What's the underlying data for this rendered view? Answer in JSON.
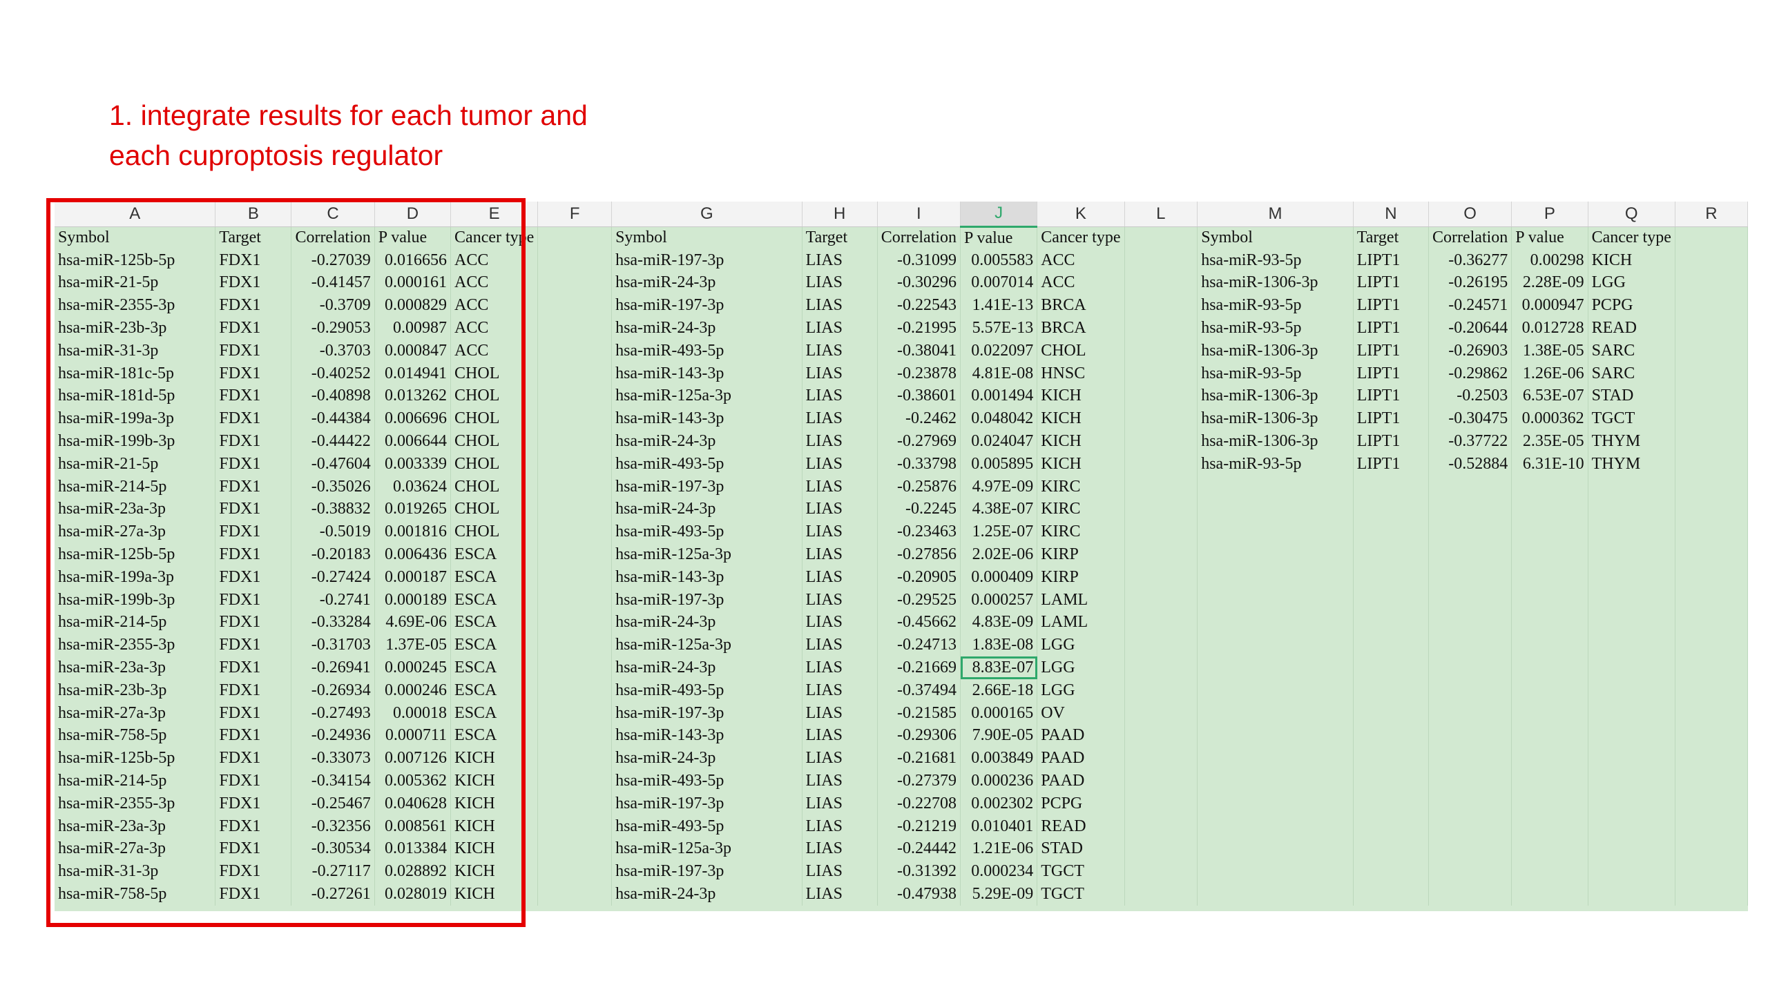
{
  "caption": {
    "line1": "1. integrate results for each tumor and",
    "line2": "each cuproptosis regulator"
  },
  "sheet": {
    "columns": [
      "A",
      "B",
      "C",
      "D",
      "E",
      "F",
      "G",
      "H",
      "I",
      "J",
      "K",
      "L",
      "M",
      "N",
      "O",
      "P",
      "Q",
      "R"
    ],
    "selected_column": "J",
    "header_row": [
      "Symbol",
      "Target",
      "Correlation",
      "P value",
      "Cancer type",
      "",
      "Symbol",
      "Target",
      "Correlation",
      "P value",
      "Cancer type",
      "",
      "Symbol",
      "Target",
      "Correlation",
      "P value",
      "Cancer type",
      ""
    ],
    "rows": [
      [
        "hsa-miR-125b-5p",
        "FDX1",
        "-0.27039",
        "0.016656",
        "ACC",
        "",
        "hsa-miR-197-3p",
        "LIAS",
        "-0.31099",
        "0.005583",
        "ACC",
        "",
        "hsa-miR-93-5p",
        "LIPT1",
        "-0.36277",
        "0.00298",
        "KICH",
        ""
      ],
      [
        "hsa-miR-21-5p",
        "FDX1",
        "-0.41457",
        "0.000161",
        "ACC",
        "",
        "hsa-miR-24-3p",
        "LIAS",
        "-0.30296",
        "0.007014",
        "ACC",
        "",
        "hsa-miR-1306-3p",
        "LIPT1",
        "-0.26195",
        "2.28E-09",
        "LGG",
        ""
      ],
      [
        "hsa-miR-2355-3p",
        "FDX1",
        "-0.3709",
        "0.000829",
        "ACC",
        "",
        "hsa-miR-197-3p",
        "LIAS",
        "-0.22543",
        "1.41E-13",
        "BRCA",
        "",
        "hsa-miR-93-5p",
        "LIPT1",
        "-0.24571",
        "0.000947",
        "PCPG",
        ""
      ],
      [
        "hsa-miR-23b-3p",
        "FDX1",
        "-0.29053",
        "0.00987",
        "ACC",
        "",
        "hsa-miR-24-3p",
        "LIAS",
        "-0.21995",
        "5.57E-13",
        "BRCA",
        "",
        "hsa-miR-93-5p",
        "LIPT1",
        "-0.20644",
        "0.012728",
        "READ",
        ""
      ],
      [
        "hsa-miR-31-3p",
        "FDX1",
        "-0.3703",
        "0.000847",
        "ACC",
        "",
        "hsa-miR-493-5p",
        "LIAS",
        "-0.38041",
        "0.022097",
        "CHOL",
        "",
        "hsa-miR-1306-3p",
        "LIPT1",
        "-0.26903",
        "1.38E-05",
        "SARC",
        ""
      ],
      [
        "hsa-miR-181c-5p",
        "FDX1",
        "-0.40252",
        "0.014941",
        "CHOL",
        "",
        "hsa-miR-143-3p",
        "LIAS",
        "-0.23878",
        "4.81E-08",
        "HNSC",
        "",
        "hsa-miR-93-5p",
        "LIPT1",
        "-0.29862",
        "1.26E-06",
        "SARC",
        ""
      ],
      [
        "hsa-miR-181d-5p",
        "FDX1",
        "-0.40898",
        "0.013262",
        "CHOL",
        "",
        "hsa-miR-125a-3p",
        "LIAS",
        "-0.38601",
        "0.001494",
        "KICH",
        "",
        "hsa-miR-1306-3p",
        "LIPT1",
        "-0.2503",
        "6.53E-07",
        "STAD",
        ""
      ],
      [
        "hsa-miR-199a-3p",
        "FDX1",
        "-0.44384",
        "0.006696",
        "CHOL",
        "",
        "hsa-miR-143-3p",
        "LIAS",
        "-0.2462",
        "0.048042",
        "KICH",
        "",
        "hsa-miR-1306-3p",
        "LIPT1",
        "-0.30475",
        "0.000362",
        "TGCT",
        ""
      ],
      [
        "hsa-miR-199b-3p",
        "FDX1",
        "-0.44422",
        "0.006644",
        "CHOL",
        "",
        "hsa-miR-24-3p",
        "LIAS",
        "-0.27969",
        "0.024047",
        "KICH",
        "",
        "hsa-miR-1306-3p",
        "LIPT1",
        "-0.37722",
        "2.35E-05",
        "THYM",
        ""
      ],
      [
        "hsa-miR-21-5p",
        "FDX1",
        "-0.47604",
        "0.003339",
        "CHOL",
        "",
        "hsa-miR-493-5p",
        "LIAS",
        "-0.33798",
        "0.005895",
        "KICH",
        "",
        "hsa-miR-93-5p",
        "LIPT1",
        "-0.52884",
        "6.31E-10",
        "THYM",
        ""
      ],
      [
        "hsa-miR-214-5p",
        "FDX1",
        "-0.35026",
        "0.03624",
        "CHOL",
        "",
        "hsa-miR-197-3p",
        "LIAS",
        "-0.25876",
        "4.97E-09",
        "KIRC",
        "",
        "",
        "",
        "",
        "",
        "",
        ""
      ],
      [
        "hsa-miR-23a-3p",
        "FDX1",
        "-0.38832",
        "0.019265",
        "CHOL",
        "",
        "hsa-miR-24-3p",
        "LIAS",
        "-0.2245",
        "4.38E-07",
        "KIRC",
        "",
        "",
        "",
        "",
        "",
        "",
        ""
      ],
      [
        "hsa-miR-27a-3p",
        "FDX1",
        "-0.5019",
        "0.001816",
        "CHOL",
        "",
        "hsa-miR-493-5p",
        "LIAS",
        "-0.23463",
        "1.25E-07",
        "KIRC",
        "",
        "",
        "",
        "",
        "",
        "",
        ""
      ],
      [
        "hsa-miR-125b-5p",
        "FDX1",
        "-0.20183",
        "0.006436",
        "ESCA",
        "",
        "hsa-miR-125a-3p",
        "LIAS",
        "-0.27856",
        "2.02E-06",
        "KIRP",
        "",
        "",
        "",
        "",
        "",
        "",
        ""
      ],
      [
        "hsa-miR-199a-3p",
        "FDX1",
        "-0.27424",
        "0.000187",
        "ESCA",
        "",
        "hsa-miR-143-3p",
        "LIAS",
        "-0.20905",
        "0.000409",
        "KIRP",
        "",
        "",
        "",
        "",
        "",
        "",
        ""
      ],
      [
        "hsa-miR-199b-3p",
        "FDX1",
        "-0.2741",
        "0.000189",
        "ESCA",
        "",
        "hsa-miR-197-3p",
        "LIAS",
        "-0.29525",
        "0.000257",
        "LAML",
        "",
        "",
        "",
        "",
        "",
        "",
        ""
      ],
      [
        "hsa-miR-214-5p",
        "FDX1",
        "-0.33284",
        "4.69E-06",
        "ESCA",
        "",
        "hsa-miR-24-3p",
        "LIAS",
        "-0.45662",
        "4.83E-09",
        "LAML",
        "",
        "",
        "",
        "",
        "",
        "",
        ""
      ],
      [
        "hsa-miR-2355-3p",
        "FDX1",
        "-0.31703",
        "1.37E-05",
        "ESCA",
        "",
        "hsa-miR-125a-3p",
        "LIAS",
        "-0.24713",
        "1.83E-08",
        "LGG",
        "",
        "",
        "",
        "",
        "",
        "",
        ""
      ],
      [
        "hsa-miR-23a-3p",
        "FDX1",
        "-0.26941",
        "0.000245",
        "ESCA",
        "",
        "hsa-miR-24-3p",
        "LIAS",
        "-0.21669",
        "8.83E-07",
        "LGG",
        "",
        "",
        "",
        "",
        "",
        "",
        ""
      ],
      [
        "hsa-miR-23b-3p",
        "FDX1",
        "-0.26934",
        "0.000246",
        "ESCA",
        "",
        "hsa-miR-493-5p",
        "LIAS",
        "-0.37494",
        "2.66E-18",
        "LGG",
        "",
        "",
        "",
        "",
        "",
        "",
        ""
      ],
      [
        "hsa-miR-27a-3p",
        "FDX1",
        "-0.27493",
        "0.00018",
        "ESCA",
        "",
        "hsa-miR-197-3p",
        "LIAS",
        "-0.21585",
        "0.000165",
        "OV",
        "",
        "",
        "",
        "",
        "",
        "",
        ""
      ],
      [
        "hsa-miR-758-5p",
        "FDX1",
        "-0.24936",
        "0.000711",
        "ESCA",
        "",
        "hsa-miR-143-3p",
        "LIAS",
        "-0.29306",
        "7.90E-05",
        "PAAD",
        "",
        "",
        "",
        "",
        "",
        "",
        ""
      ],
      [
        "hsa-miR-125b-5p",
        "FDX1",
        "-0.33073",
        "0.007126",
        "KICH",
        "",
        "hsa-miR-24-3p",
        "LIAS",
        "-0.21681",
        "0.003849",
        "PAAD",
        "",
        "",
        "",
        "",
        "",
        "",
        ""
      ],
      [
        "hsa-miR-214-5p",
        "FDX1",
        "-0.34154",
        "0.005362",
        "KICH",
        "",
        "hsa-miR-493-5p",
        "LIAS",
        "-0.27379",
        "0.000236",
        "PAAD",
        "",
        "",
        "",
        "",
        "",
        "",
        ""
      ],
      [
        "hsa-miR-2355-3p",
        "FDX1",
        "-0.25467",
        "0.040628",
        "KICH",
        "",
        "hsa-miR-197-3p",
        "LIAS",
        "-0.22708",
        "0.002302",
        "PCPG",
        "",
        "",
        "",
        "",
        "",
        "",
        ""
      ],
      [
        "hsa-miR-23a-3p",
        "FDX1",
        "-0.32356",
        "0.008561",
        "KICH",
        "",
        "hsa-miR-493-5p",
        "LIAS",
        "-0.21219",
        "0.010401",
        "READ",
        "",
        "",
        "",
        "",
        "",
        "",
        ""
      ],
      [
        "hsa-miR-27a-3p",
        "FDX1",
        "-0.30534",
        "0.013384",
        "KICH",
        "",
        "hsa-miR-125a-3p",
        "LIAS",
        "-0.24442",
        "1.21E-06",
        "STAD",
        "",
        "",
        "",
        "",
        "",
        "",
        ""
      ],
      [
        "hsa-miR-31-3p",
        "FDX1",
        "-0.27117",
        "0.028892",
        "KICH",
        "",
        "hsa-miR-197-3p",
        "LIAS",
        "-0.31392",
        "0.000234",
        "TGCT",
        "",
        "",
        "",
        "",
        "",
        "",
        ""
      ],
      [
        "hsa-miR-758-5p",
        "FDX1",
        "-0.27261",
        "0.028019",
        "KICH",
        "",
        "hsa-miR-24-3p",
        "LIAS",
        "-0.47938",
        "5.29E-09",
        "TGCT",
        "",
        "",
        "",
        "",
        "",
        "",
        ""
      ]
    ],
    "selected_cell": {
      "row": 18,
      "col": 9
    },
    "colors": {
      "highlight_frame": "#e50000",
      "sheet_fill": "#d2e9d1",
      "selection": "#2ea86b",
      "caption": "#e00000"
    }
  }
}
